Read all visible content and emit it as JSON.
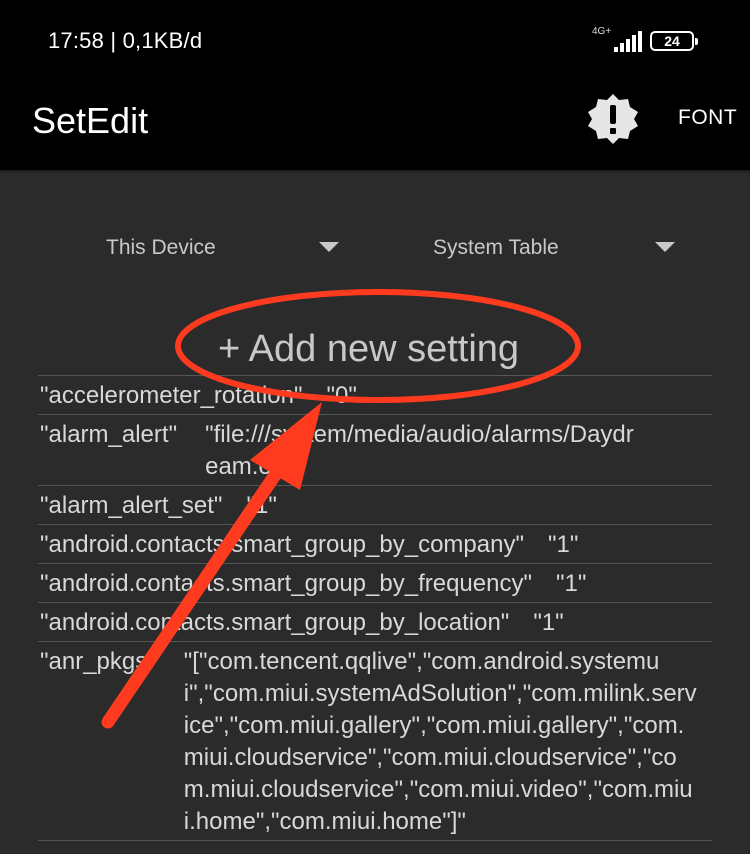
{
  "status_bar": {
    "time_speed": "17:58 | 0,1KB/d",
    "network": "4G+",
    "battery": "24"
  },
  "app_bar": {
    "title": "SetEdit",
    "alert_icon": "alert-badge-icon",
    "font_label": "FONT"
  },
  "selectors": {
    "device": "This Device",
    "table": "System Table"
  },
  "add_setting_label": "+ Add new setting",
  "settings": [
    {
      "key": "\"accelerometer_rotation\"",
      "value": "\"0\""
    },
    {
      "key": "\"alarm_alert\"",
      "value": "\"file:///system/media/audio/alarms/Daydream.ogg\""
    },
    {
      "key": "\"alarm_alert_set\"",
      "value": "\"1\""
    },
    {
      "key": "\"android.contacts.smart_group_by_company\"",
      "value": "\"1\""
    },
    {
      "key": "\"android.contacts.smart_group_by_frequency\"",
      "value": "\"1\""
    },
    {
      "key": "\"android.contacts.smart_group_by_location\"",
      "value": "\"1\""
    },
    {
      "key": "\"anr_pkgs\"",
      "value": "\"[\"com.tencent.qqlive\",\"com.android.systemui\",\"com.miui.systemAdSolution\",\"com.milink.service\",\"com.miui.gallery\",\"com.miui.gallery\",\"com.miui.cloudservice\",\"com.miui.cloudservice\",\"com.miui.cloudservice\",\"com.miui.video\",\"com.miui.home\",\"com.miui.home\"]\""
    }
  ],
  "annotation_colors": {
    "highlight": "#ff3b1f"
  }
}
